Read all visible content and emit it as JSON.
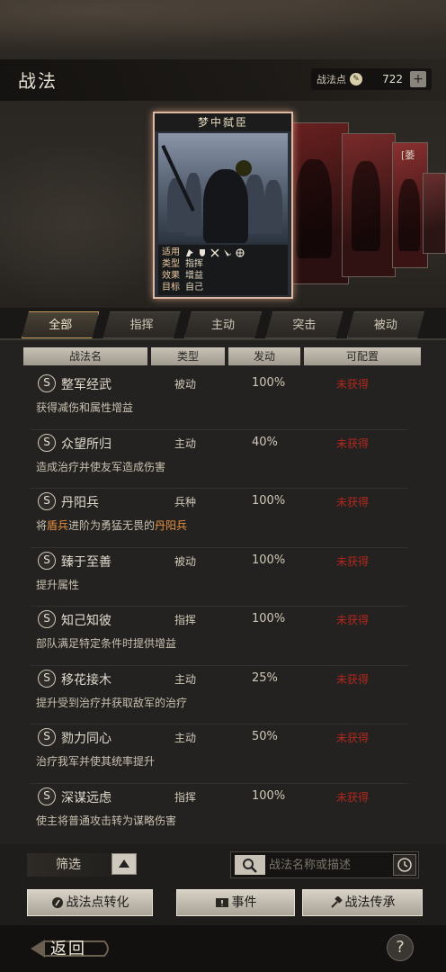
{
  "header": {
    "title": "战法",
    "points_label": "战法点",
    "points_value": "722",
    "plus_label": "+"
  },
  "featured_card": {
    "title": "梦中弑臣",
    "info": [
      {
        "key": "适用",
        "value": ""
      },
      {
        "key": "类型",
        "value": "指挥"
      },
      {
        "key": "效果",
        "value": "增益"
      },
      {
        "key": "目标",
        "value": "自己"
      }
    ],
    "side_tag": "[萎"
  },
  "tabs": [
    "全部",
    "指挥",
    "主动",
    "突击",
    "被动"
  ],
  "active_tab": "全部",
  "columns": [
    "战法名",
    "类型",
    "发动",
    "可配置"
  ],
  "rows": [
    {
      "badge": "S",
      "name": "整军经武",
      "type": "被动",
      "rate": "100%",
      "status": "未获得",
      "desc_parts": [
        {
          "t": "获得减伤和属性增益",
          "hl": false
        }
      ]
    },
    {
      "badge": "S",
      "name": "众望所归",
      "type": "主动",
      "rate": "40%",
      "status": "未获得",
      "desc_parts": [
        {
          "t": "造成治疗并使友军造成伤害",
          "hl": false
        }
      ]
    },
    {
      "badge": "S",
      "name": "丹阳兵",
      "type": "兵种",
      "rate": "100%",
      "status": "未获得",
      "desc_parts": [
        {
          "t": "将",
          "hl": false
        },
        {
          "t": "盾兵",
          "hl": true
        },
        {
          "t": "进阶为勇猛无畏的",
          "hl": false
        },
        {
          "t": "丹阳兵",
          "hl": true
        }
      ]
    },
    {
      "badge": "S",
      "name": "臻于至善",
      "type": "被动",
      "rate": "100%",
      "status": "未获得",
      "desc_parts": [
        {
          "t": "提升属性",
          "hl": false
        }
      ]
    },
    {
      "badge": "S",
      "name": "知己知彼",
      "type": "指挥",
      "rate": "100%",
      "status": "未获得",
      "desc_parts": [
        {
          "t": "部队满足特定条件时提供增益",
          "hl": false
        }
      ]
    },
    {
      "badge": "S",
      "name": "移花接木",
      "type": "主动",
      "rate": "25%",
      "status": "未获得",
      "desc_parts": [
        {
          "t": "提升受到治疗并获取敌军的治疗",
          "hl": false
        }
      ]
    },
    {
      "badge": "S",
      "name": "勠力同心",
      "type": "主动",
      "rate": "50%",
      "status": "未获得",
      "desc_parts": [
        {
          "t": "治疗我军并使其统率提升",
          "hl": false
        }
      ]
    },
    {
      "badge": "S",
      "name": "深谋远虑",
      "type": "指挥",
      "rate": "100%",
      "status": "未获得",
      "desc_parts": [
        {
          "t": "使主将普通攻击转为谋略伤害",
          "hl": false
        }
      ]
    }
  ],
  "filter": {
    "label": "筛选",
    "search_placeholder": "战法名称或描述"
  },
  "actions": {
    "convert": "战法点转化",
    "event": "事件",
    "inherit": "战法传承"
  },
  "footer": {
    "back": "返回",
    "help": "?"
  }
}
